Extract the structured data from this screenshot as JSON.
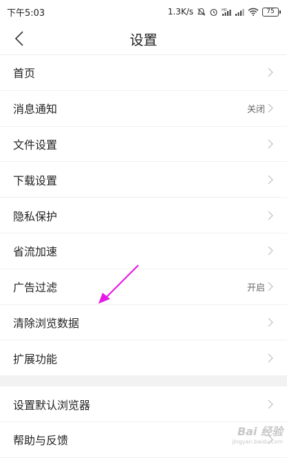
{
  "status_bar": {
    "time": "下午5:03",
    "network_speed": "1.3K/s",
    "battery": "75",
    "icons": [
      "mute-icon",
      "alarm-icon",
      "hd-signal-icon",
      "signal-icon",
      "wifi-icon",
      "battery-icon"
    ]
  },
  "header": {
    "title": "设置",
    "back_icon": "chevron-left-icon"
  },
  "settings": {
    "group1": [
      {
        "label": "首页",
        "value": ""
      },
      {
        "label": "消息通知",
        "value": "关闭"
      },
      {
        "label": "文件设置",
        "value": ""
      },
      {
        "label": "下载设置",
        "value": ""
      },
      {
        "label": "隐私保护",
        "value": ""
      },
      {
        "label": "省流加速",
        "value": ""
      },
      {
        "label": "广告过滤",
        "value": "开启"
      },
      {
        "label": "清除浏览数据",
        "value": ""
      },
      {
        "label": "扩展功能",
        "value": ""
      }
    ],
    "group2": [
      {
        "label": "设置默认浏览器",
        "value": ""
      },
      {
        "label": "帮助与反馈",
        "value": ""
      }
    ]
  },
  "annotation": {
    "arrow_color": "#e619e6"
  },
  "watermark": {
    "text": "Bai 经验",
    "sub": "jingyan.baidu.com"
  },
  "colors": {
    "separator": "#f2f2f2",
    "chevron": "#c4c4c4",
    "text": "#222222"
  }
}
